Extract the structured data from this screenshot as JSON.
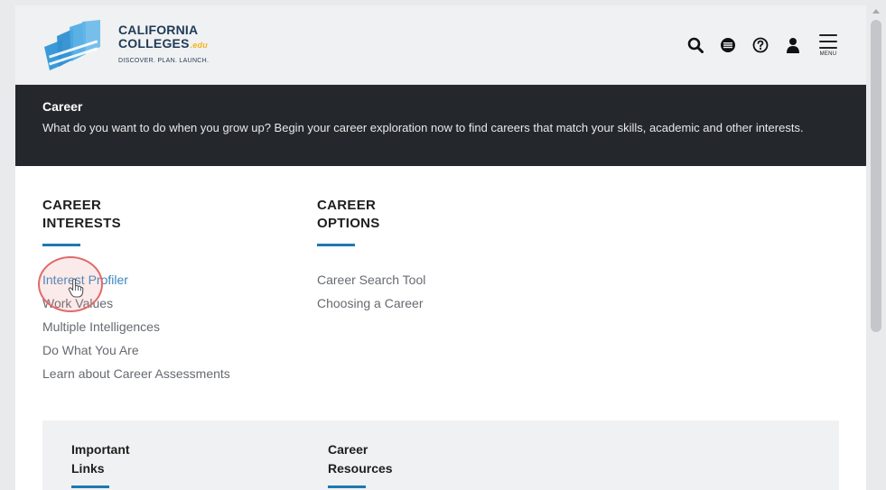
{
  "header": {
    "logo": {
      "line1": "CALIFORNIA",
      "line2": "COLLEGES",
      "edu": ".edu",
      "tagline": "DISCOVER. PLAN. LAUNCH."
    },
    "icons": [
      "search-icon",
      "globe-icon",
      "help-icon",
      "user-icon",
      "menu-icon"
    ],
    "menu_label": "MENU"
  },
  "banner": {
    "title": "Career",
    "description": "What do you want to do when you grow up? Begin your career exploration now to find careers that match your skills, academic and other interests."
  },
  "career_interests": {
    "heading": "CAREER INTERESTS",
    "links": [
      "Interest Profiler",
      "Work Values",
      "Multiple Intelligences",
      "Do What You Are",
      "Learn about Career Assessments"
    ]
  },
  "career_options": {
    "heading": "CAREER OPTIONS",
    "links": [
      "Career Search Tool",
      "Choosing a Career"
    ]
  },
  "lower": {
    "important_links": "Important Links",
    "career_resources": "Career Resources"
  },
  "colors": {
    "accent_blue": "#1f78b4",
    "banner_bg": "#24282d",
    "active_link": "#3a86bf",
    "logo_navy": "#1f3b57",
    "logo_gold": "#f3b51b"
  }
}
